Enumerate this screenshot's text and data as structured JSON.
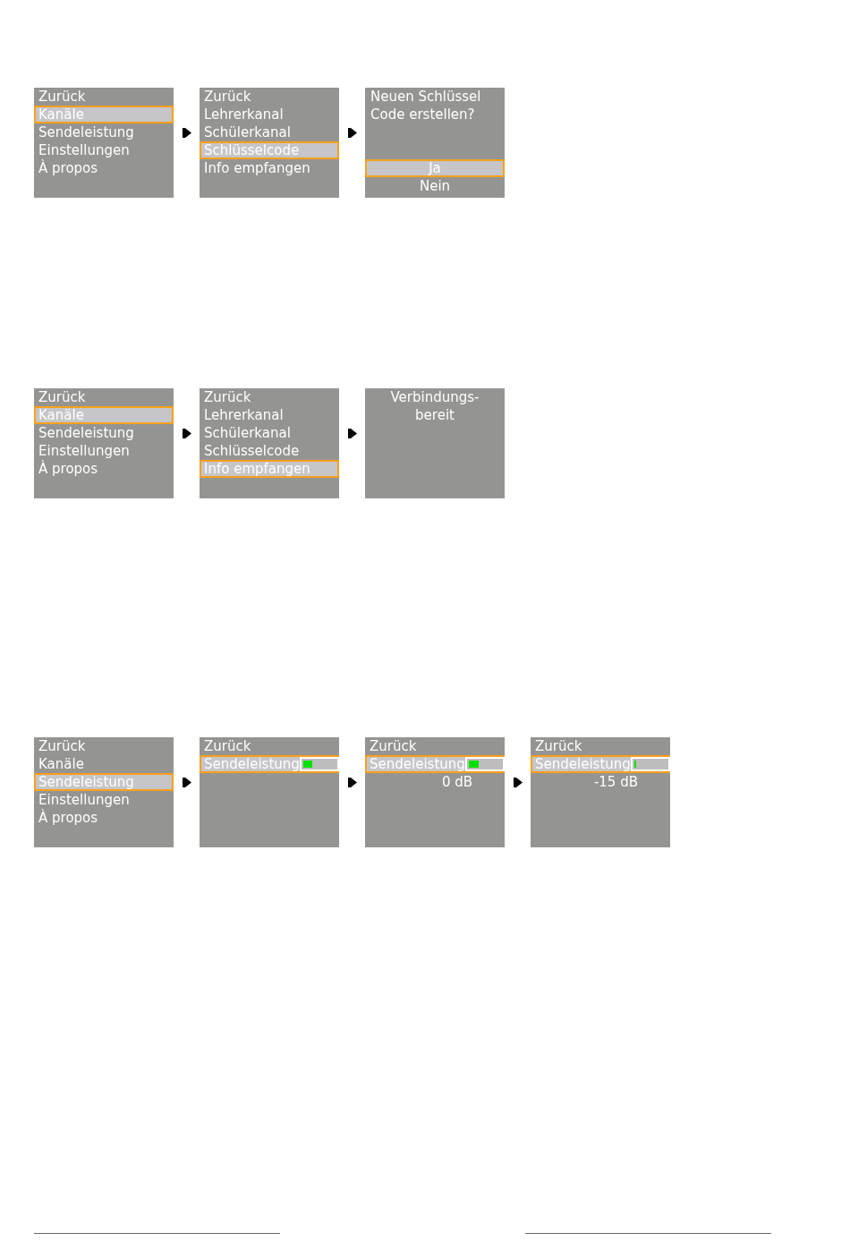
{
  "menu_sequences": [
    {
      "screens": [
        {
          "kind": "menu",
          "items": [
            {
              "label": "Zurück",
              "selected": false
            },
            {
              "label": "Kanäle",
              "selected": true
            },
            {
              "label": "Sendeleistung",
              "selected": false
            },
            {
              "label": "Einstellungen",
              "selected": false
            },
            {
              "label": "À propos",
              "selected": false
            }
          ]
        },
        {
          "kind": "menu",
          "items": [
            {
              "label": "Zurück",
              "selected": false
            },
            {
              "label": "Lehrerkanal",
              "selected": false
            },
            {
              "label": "Schülerkanal",
              "selected": false
            },
            {
              "label": "Schlüsselcode",
              "selected": true
            },
            {
              "label": "Info empfangen",
              "selected": false
            }
          ]
        },
        {
          "kind": "dialog",
          "message": [
            "Neuen Schlüssel",
            "Code erstellen?"
          ],
          "options": [
            {
              "label": "Ja",
              "selected": true
            },
            {
              "label": "Nein",
              "selected": false
            }
          ]
        }
      ]
    },
    {
      "screens": [
        {
          "kind": "menu",
          "items": [
            {
              "label": "Zurück",
              "selected": false
            },
            {
              "label": "Kanäle",
              "selected": true
            },
            {
              "label": "Sendeleistung",
              "selected": false
            },
            {
              "label": "Einstellungen",
              "selected": false
            },
            {
              "label": "À propos",
              "selected": false
            }
          ]
        },
        {
          "kind": "menu",
          "items": [
            {
              "label": "Zurück",
              "selected": false
            },
            {
              "label": "Lehrerkanal",
              "selected": false
            },
            {
              "label": "Schülerkanal",
              "selected": false
            },
            {
              "label": "Schlüsselcode",
              "selected": false
            },
            {
              "label": "Info empfangen",
              "selected": true
            }
          ]
        },
        {
          "kind": "message",
          "lines": [
            "Verbindungs-",
            "bereit"
          ]
        }
      ]
    },
    {
      "screens": [
        {
          "kind": "menu",
          "items": [
            {
              "label": "Zurück",
              "selected": false
            },
            {
              "label": "Kanäle",
              "selected": false
            },
            {
              "label": "Sendeleistung",
              "selected": true
            },
            {
              "label": "Einstellungen",
              "selected": false
            },
            {
              "label": "À propos",
              "selected": false
            }
          ]
        },
        {
          "kind": "menu",
          "items": [
            {
              "kind": "entry",
              "label": "Zurück",
              "selected": false
            },
            {
              "kind": "slider",
              "label": "Sendeleistung",
              "selected": true,
              "level": 0.28
            }
          ]
        },
        {
          "kind": "menu",
          "items": [
            {
              "kind": "entry",
              "label": "Zurück",
              "selected": false
            },
            {
              "kind": "slider",
              "label": "Sendeleistung",
              "selected": true,
              "level": 0.3
            }
          ],
          "reading": "0 dB"
        },
        {
          "kind": "menu",
          "items": [
            {
              "kind": "entry",
              "label": "Zurück",
              "selected": false
            },
            {
              "kind": "slider",
              "label": "Sendeleistung",
              "selected": true,
              "level": 0.07
            }
          ],
          "reading": "-15 dB"
        }
      ]
    }
  ]
}
